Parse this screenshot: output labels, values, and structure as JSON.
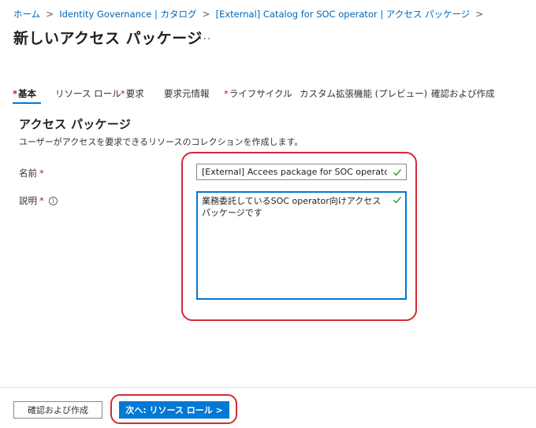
{
  "breadcrumb": {
    "items": [
      "ホーム",
      "Identity Governance | カタログ",
      "[External] Catalog for SOC operator | アクセス パッケージ"
    ],
    "separator": ">"
  },
  "header": {
    "title": "新しいアクセス パッケージ",
    "more": "..."
  },
  "tabs": [
    {
      "label": "基本",
      "required": "*"
    },
    {
      "label": "リソース ロール",
      "required": ""
    },
    {
      "label": "要求",
      "required": "*"
    },
    {
      "label": "要求元情報",
      "required": ""
    },
    {
      "label": "ライフサイクル",
      "required": "*"
    },
    {
      "label": "カスタム拡張機能 (プレビュー)",
      "required": ""
    },
    {
      "label": "確認および作成",
      "required": ""
    }
  ],
  "section": {
    "title": "アクセス パッケージ",
    "description": "ユーザーがアクセスを要求できるリソースのコレクションを作成します。"
  },
  "form": {
    "name_label": "名前",
    "name_value": "[External] Accees package for SOC operator",
    "description_label": "説明",
    "description_value": "業務委託しているSOC operator向けアクセス パッケージです",
    "required_mark": "*",
    "info_glyph": "i"
  },
  "footer": {
    "review_button": "確認および作成",
    "next_button": "次へ: リソース ロール >"
  },
  "colors": {
    "accent": "#0078d4",
    "link": "#0067b8",
    "required": "#a4262c",
    "valid": "#107c10",
    "highlight": "#d42a3a"
  },
  "icons": {
    "name_valid": "checkmark-icon",
    "description_valid": "checkmark-icon",
    "description_info": "info-icon"
  }
}
